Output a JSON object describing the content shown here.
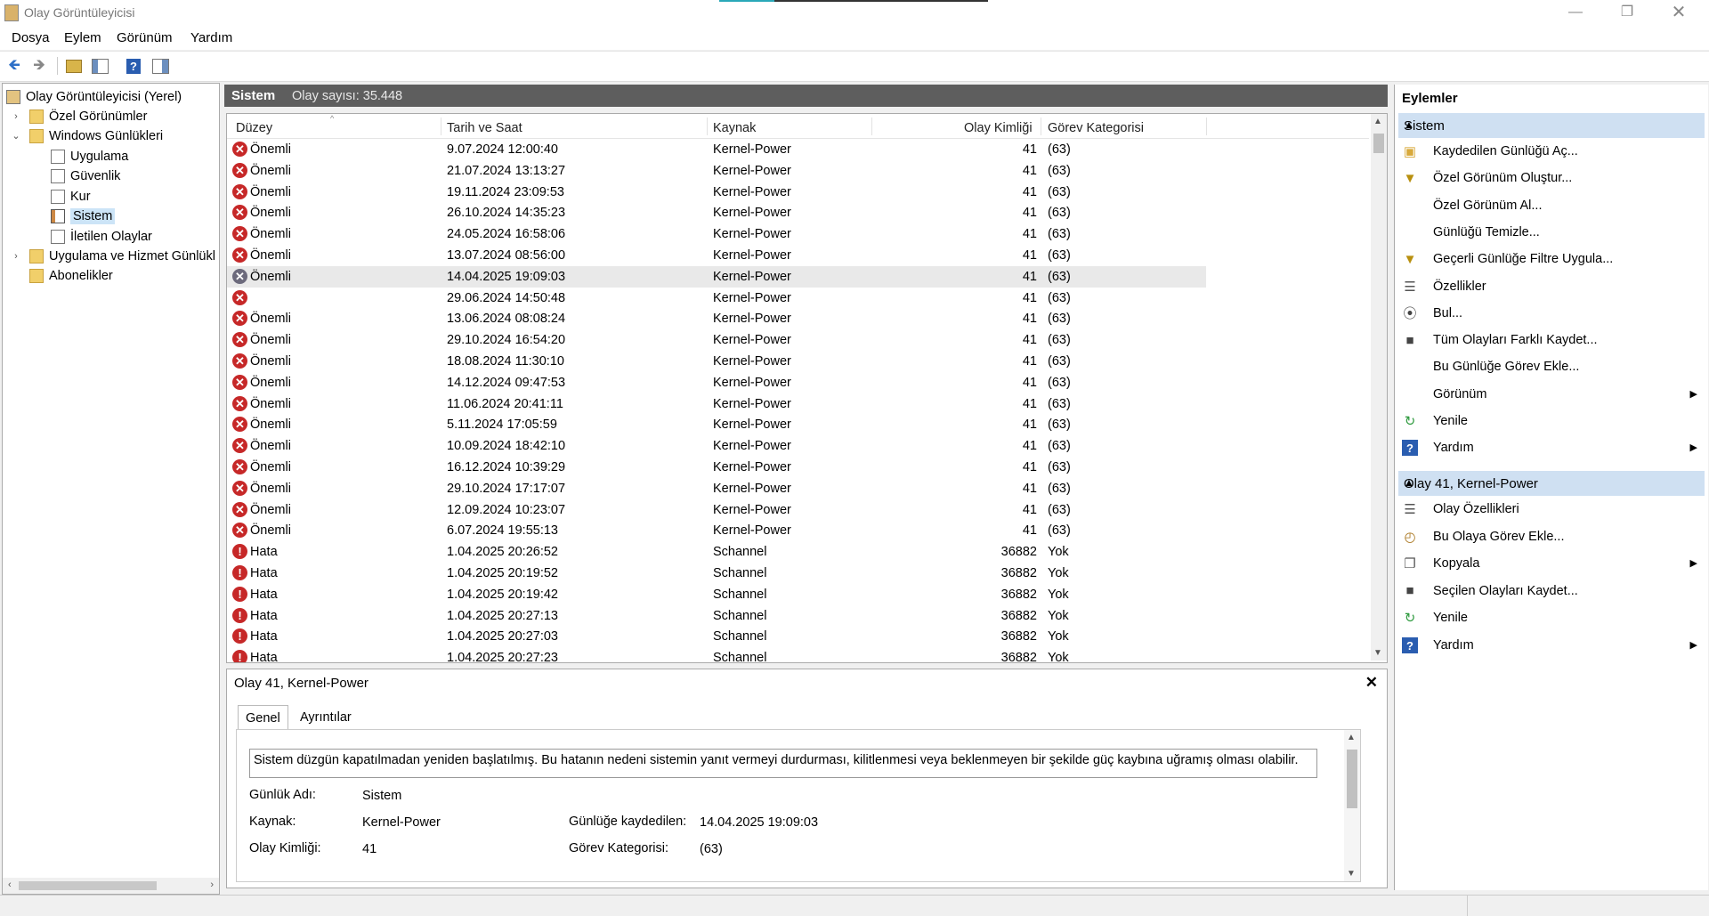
{
  "window": {
    "title": "Olay Görüntüleyicisi"
  },
  "menu": [
    "Dosya",
    "Eylem",
    "Görünüm",
    "Yardım"
  ],
  "tree": {
    "root": "Olay Görüntüleyicisi (Yerel)",
    "custom_views": "Özel Görünümler",
    "windows_logs": "Windows Günlükleri",
    "logs": [
      "Uygulama",
      "Güvenlik",
      "Kur",
      "Sistem",
      "İletilen Olaylar"
    ],
    "app_service_logs": "Uygulama ve Hizmet Günlükl",
    "subscriptions": "Abonelikler"
  },
  "center": {
    "log_name": "Sistem",
    "event_count": "Olay sayısı: 35.448"
  },
  "columns": [
    "Düzey",
    "Tarih ve Saat",
    "Kaynak",
    "Olay Kimliği",
    "Görev Kategorisi"
  ],
  "events": [
    {
      "level": "Önemli",
      "date": "9.07.2024 12:00:40",
      "source": "Kernel-Power",
      "id": "41",
      "cat": "(63)",
      "icon": "critical"
    },
    {
      "level": "Önemli",
      "date": "21.07.2024 13:13:27",
      "source": "Kernel-Power",
      "id": "41",
      "cat": "(63)",
      "icon": "critical"
    },
    {
      "level": "Önemli",
      "date": "19.11.2024 23:09:53",
      "source": "Kernel-Power",
      "id": "41",
      "cat": "(63)",
      "icon": "critical"
    },
    {
      "level": "Önemli",
      "date": "26.10.2024 14:35:23",
      "source": "Kernel-Power",
      "id": "41",
      "cat": "(63)",
      "icon": "critical"
    },
    {
      "level": "Önemli",
      "date": "24.05.2024 16:58:06",
      "source": "Kernel-Power",
      "id": "41",
      "cat": "(63)",
      "icon": "critical"
    },
    {
      "level": "Önemli",
      "date": "13.07.2024 08:56:00",
      "source": "Kernel-Power",
      "id": "41",
      "cat": "(63)",
      "icon": "critical"
    },
    {
      "level": "Önemli",
      "date": "14.04.2025 19:09:03",
      "source": "Kernel-Power",
      "id": "41",
      "cat": "(63)",
      "icon": "critical-selected"
    },
    {
      "level": "",
      "date": "29.06.2024 14:50:48",
      "source": "Kernel-Power",
      "id": "41",
      "cat": "(63)",
      "icon": "critical"
    },
    {
      "level": "Önemli",
      "date": "13.06.2024 08:08:24",
      "source": "Kernel-Power",
      "id": "41",
      "cat": "(63)",
      "icon": "critical"
    },
    {
      "level": "Önemli",
      "date": "29.10.2024 16:54:20",
      "source": "Kernel-Power",
      "id": "41",
      "cat": "(63)",
      "icon": "critical"
    },
    {
      "level": "Önemli",
      "date": "18.08.2024 11:30:10",
      "source": "Kernel-Power",
      "id": "41",
      "cat": "(63)",
      "icon": "critical"
    },
    {
      "level": "Önemli",
      "date": "14.12.2024 09:47:53",
      "source": "Kernel-Power",
      "id": "41",
      "cat": "(63)",
      "icon": "critical"
    },
    {
      "level": "Önemli",
      "date": "11.06.2024 20:41:11",
      "source": "Kernel-Power",
      "id": "41",
      "cat": "(63)",
      "icon": "critical"
    },
    {
      "level": "Önemli",
      "date": "5.11.2024 17:05:59",
      "source": "Kernel-Power",
      "id": "41",
      "cat": "(63)",
      "icon": "critical"
    },
    {
      "level": "Önemli",
      "date": "10.09.2024 18:42:10",
      "source": "Kernel-Power",
      "id": "41",
      "cat": "(63)",
      "icon": "critical"
    },
    {
      "level": "Önemli",
      "date": "16.12.2024 10:39:29",
      "source": "Kernel-Power",
      "id": "41",
      "cat": "(63)",
      "icon": "critical"
    },
    {
      "level": "Önemli",
      "date": "29.10.2024 17:17:07",
      "source": "Kernel-Power",
      "id": "41",
      "cat": "(63)",
      "icon": "critical"
    },
    {
      "level": "Önemli",
      "date": "12.09.2024 10:23:07",
      "source": "Kernel-Power",
      "id": "41",
      "cat": "(63)",
      "icon": "critical"
    },
    {
      "level": "Önemli",
      "date": "6.07.2024 19:55:13",
      "source": "Kernel-Power",
      "id": "41",
      "cat": "(63)",
      "icon": "critical"
    },
    {
      "level": "Hata",
      "date": "1.04.2025 20:26:52",
      "source": "Schannel",
      "id": "36882",
      "cat": "Yok",
      "icon": "error"
    },
    {
      "level": "Hata",
      "date": "1.04.2025 20:19:52",
      "source": "Schannel",
      "id": "36882",
      "cat": "Yok",
      "icon": "error"
    },
    {
      "level": "Hata",
      "date": "1.04.2025 20:19:42",
      "source": "Schannel",
      "id": "36882",
      "cat": "Yok",
      "icon": "error"
    },
    {
      "level": "Hata",
      "date": "1.04.2025 20:27:13",
      "source": "Schannel",
      "id": "36882",
      "cat": "Yok",
      "icon": "error"
    },
    {
      "level": "Hata",
      "date": "1.04.2025 20:27:03",
      "source": "Schannel",
      "id": "36882",
      "cat": "Yok",
      "icon": "error"
    },
    {
      "level": "Hata",
      "date": "1.04.2025 20:27:23",
      "source": "Schannel",
      "id": "36882",
      "cat": "Yok",
      "icon": "error"
    }
  ],
  "details": {
    "title": "Olay 41, Kernel-Power",
    "tabs": [
      "Genel",
      "Ayrıntılar"
    ],
    "description": "Sistem düzgün kapatılmadan yeniden başlatılmış. Bu hatanın nedeni sistemin yanıt vermeyi durdurması, kilitlenmesi veya beklenmeyen bir şekilde güç kaybına uğramış olması olabilir.",
    "log_name_label": "Günlük Adı:",
    "log_name": "Sistem",
    "source_label": "Kaynak:",
    "source": "Kernel-Power",
    "logged_label": "Günlüğe kaydedilen:",
    "logged": "14.04.2025 19:09:03",
    "event_id_label": "Olay Kimliği:",
    "event_id": "41",
    "task_cat_label": "Görev Kategorisi:",
    "task_cat": "(63)"
  },
  "actions": {
    "title": "Eylemler",
    "section1": "Sistem",
    "items1": [
      {
        "label": "Kaydedilen Günlüğü Aç...",
        "icon": "folder-open-icon"
      },
      {
        "label": "Özel Görünüm Oluştur...",
        "icon": "filter-icon"
      },
      {
        "label": "Özel Görünüm Al...",
        "icon": ""
      },
      {
        "label": "Günlüğü Temizle...",
        "icon": ""
      },
      {
        "label": "Geçerli Günlüğe Filtre Uygula...",
        "icon": "filter-icon"
      },
      {
        "label": "Özellikler",
        "icon": "properties-icon"
      },
      {
        "label": "Bul...",
        "icon": "binoculars-icon"
      },
      {
        "label": "Tüm Olayları Farklı Kaydet...",
        "icon": "save-icon"
      },
      {
        "label": "Bu Günlüğe Görev Ekle...",
        "icon": ""
      },
      {
        "label": "Görünüm",
        "icon": "",
        "submenu": true
      },
      {
        "label": "Yenile",
        "icon": "refresh-icon"
      },
      {
        "label": "Yardım",
        "icon": "help-icon",
        "submenu": true
      }
    ],
    "section2": "Olay 41, Kernel-Power",
    "items2": [
      {
        "label": "Olay Özellikleri",
        "icon": "properties-icon"
      },
      {
        "label": "Bu Olaya Görev Ekle...",
        "icon": "task-icon"
      },
      {
        "label": "Kopyala",
        "icon": "copy-icon",
        "submenu": true
      },
      {
        "label": "Seçilen Olayları Kaydet...",
        "icon": "save-icon"
      },
      {
        "label": "Yenile",
        "icon": "refresh-icon"
      },
      {
        "label": "Yardım",
        "icon": "help-icon",
        "submenu": true
      }
    ]
  }
}
